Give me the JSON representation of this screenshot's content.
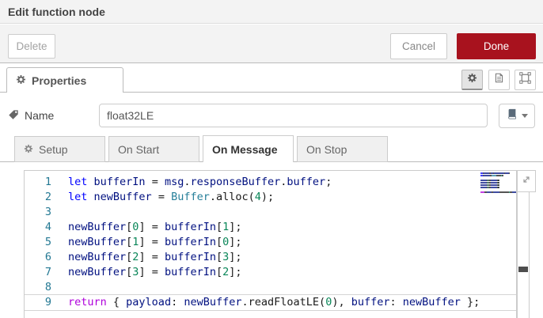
{
  "header": {
    "title": "Edit function node"
  },
  "footer_buttons": {
    "delete": "Delete",
    "cancel": "Cancel",
    "done": "Done"
  },
  "properties_bar": {
    "tab_label": "Properties"
  },
  "name_row": {
    "label": "Name",
    "value": "float32LE"
  },
  "editor_tabs": [
    {
      "label": "Setup",
      "icon": "gear-icon",
      "active": false
    },
    {
      "label": "On Start",
      "active": false
    },
    {
      "label": "On Message",
      "active": true
    },
    {
      "label": "On Stop",
      "active": false
    }
  ],
  "colors": {
    "accent": "#a8121e",
    "line_number": "#237893"
  },
  "code_editor": {
    "token_colors": {
      "keyword": "#0000ff",
      "control": "#af00db",
      "variable": "#001080",
      "class": "#267f99",
      "number": "#098658",
      "default": "#1b1b1b"
    },
    "active_line": 9,
    "lines": [
      {
        "n": 1,
        "tokens": [
          [
            "let",
            "keyword"
          ],
          [
            " ",
            "default"
          ],
          [
            "bufferIn",
            "variable"
          ],
          [
            " = ",
            "default"
          ],
          [
            "msg",
            "variable"
          ],
          [
            ".",
            "default"
          ],
          [
            "responseBuffer",
            "variable"
          ],
          [
            ".",
            "default"
          ],
          [
            "buffer",
            "variable"
          ],
          [
            ";",
            "default"
          ]
        ]
      },
      {
        "n": 2,
        "tokens": [
          [
            "let",
            "keyword"
          ],
          [
            " ",
            "default"
          ],
          [
            "newBuffer",
            "variable"
          ],
          [
            " = ",
            "default"
          ],
          [
            "Buffer",
            "class"
          ],
          [
            ".",
            "default"
          ],
          [
            "alloc",
            "default"
          ],
          [
            "(",
            "default"
          ],
          [
            "4",
            "number"
          ],
          [
            ");",
            "default"
          ]
        ]
      },
      {
        "n": 3,
        "tokens": []
      },
      {
        "n": 4,
        "tokens": [
          [
            "newBuffer",
            "variable"
          ],
          [
            "[",
            "default"
          ],
          [
            "0",
            "number"
          ],
          [
            "]",
            "default"
          ],
          [
            " = ",
            "default"
          ],
          [
            "bufferIn",
            "variable"
          ],
          [
            "[",
            "default"
          ],
          [
            "1",
            "number"
          ],
          [
            "];",
            "default"
          ]
        ]
      },
      {
        "n": 5,
        "tokens": [
          [
            "newBuffer",
            "variable"
          ],
          [
            "[",
            "default"
          ],
          [
            "1",
            "number"
          ],
          [
            "]",
            "default"
          ],
          [
            " = ",
            "default"
          ],
          [
            "bufferIn",
            "variable"
          ],
          [
            "[",
            "default"
          ],
          [
            "0",
            "number"
          ],
          [
            "];",
            "default"
          ]
        ]
      },
      {
        "n": 6,
        "tokens": [
          [
            "newBuffer",
            "variable"
          ],
          [
            "[",
            "default"
          ],
          [
            "2",
            "number"
          ],
          [
            "]",
            "default"
          ],
          [
            " = ",
            "default"
          ],
          [
            "bufferIn",
            "variable"
          ],
          [
            "[",
            "default"
          ],
          [
            "3",
            "number"
          ],
          [
            "];",
            "default"
          ]
        ]
      },
      {
        "n": 7,
        "tokens": [
          [
            "newBuffer",
            "variable"
          ],
          [
            "[",
            "default"
          ],
          [
            "3",
            "number"
          ],
          [
            "]",
            "default"
          ],
          [
            " = ",
            "default"
          ],
          [
            "bufferIn",
            "variable"
          ],
          [
            "[",
            "default"
          ],
          [
            "2",
            "number"
          ],
          [
            "];",
            "default"
          ]
        ]
      },
      {
        "n": 8,
        "tokens": []
      },
      {
        "n": 9,
        "tokens": [
          [
            "return",
            "control"
          ],
          [
            " { ",
            "default"
          ],
          [
            "payload",
            "variable"
          ],
          [
            ": ",
            "default"
          ],
          [
            "newBuffer",
            "variable"
          ],
          [
            ".",
            "default"
          ],
          [
            "readFloatLE",
            "default"
          ],
          [
            "(",
            "default"
          ],
          [
            "0",
            "number"
          ],
          [
            "), ",
            "default"
          ],
          [
            "buffer",
            "variable"
          ],
          [
            ": ",
            "default"
          ],
          [
            "newBuffer",
            "variable"
          ],
          [
            " };",
            "default"
          ]
        ]
      }
    ]
  }
}
